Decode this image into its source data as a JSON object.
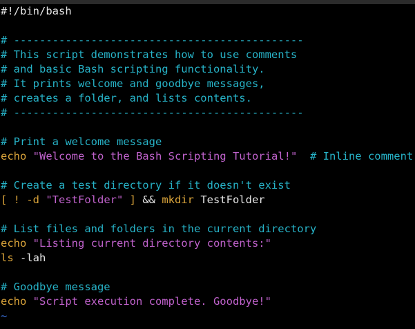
{
  "editor": {
    "lines": [
      [
        {
          "t": "#!/bin/bash",
          "c": "white"
        }
      ],
      [],
      [
        {
          "t": "# ---------------------------------------------",
          "c": "comment"
        }
      ],
      [
        {
          "t": "# This script demonstrates how to use comments",
          "c": "comment"
        }
      ],
      [
        {
          "t": "# and basic Bash scripting functionality.",
          "c": "comment"
        }
      ],
      [
        {
          "t": "# It prints welcome and goodbye messages,",
          "c": "comment"
        }
      ],
      [
        {
          "t": "# creates a folder, and lists contents.",
          "c": "comment"
        }
      ],
      [
        {
          "t": "# ---------------------------------------------",
          "c": "comment"
        }
      ],
      [],
      [
        {
          "t": "# Print a welcome message",
          "c": "comment"
        }
      ],
      [
        {
          "t": "echo ",
          "c": "keyword"
        },
        {
          "t": "\"Welcome to the Bash Scripting Tutorial!\"",
          "c": "string"
        },
        {
          "t": "  ",
          "c": "plain"
        },
        {
          "t": "# Inline comment",
          "c": "comment"
        }
      ],
      [],
      [
        {
          "t": "# Create a test directory if it doesn't exist",
          "c": "comment"
        }
      ],
      [
        {
          "t": "[ ! -d ",
          "c": "op"
        },
        {
          "t": "\"TestFolder\"",
          "c": "string"
        },
        {
          "t": " ] ",
          "c": "op"
        },
        {
          "t": "&& ",
          "c": "plain"
        },
        {
          "t": "mkdir",
          "c": "keyword"
        },
        {
          "t": " TestFolder",
          "c": "plain"
        }
      ],
      [],
      [
        {
          "t": "# List files and folders in the current directory",
          "c": "comment"
        }
      ],
      [
        {
          "t": "echo ",
          "c": "keyword"
        },
        {
          "t": "\"Listing current directory contents:\"",
          "c": "string"
        }
      ],
      [
        {
          "t": "ls",
          "c": "keyword"
        },
        {
          "t": " -lah",
          "c": "plain"
        }
      ],
      [],
      [
        {
          "t": "# Goodbye message",
          "c": "comment"
        }
      ],
      [
        {
          "t": "echo ",
          "c": "keyword"
        },
        {
          "t": "\"Script execution complete. Goodbye!\"",
          "c": "string"
        }
      ],
      [
        {
          "t": "~",
          "c": "tilde"
        }
      ]
    ]
  },
  "colors": {
    "background": "#000000",
    "comment": "#27b3c8",
    "keyword": "#d9a33a",
    "string": "#c062cc",
    "plain": "#e6e6e6",
    "tilde": "#3a6fd8"
  }
}
